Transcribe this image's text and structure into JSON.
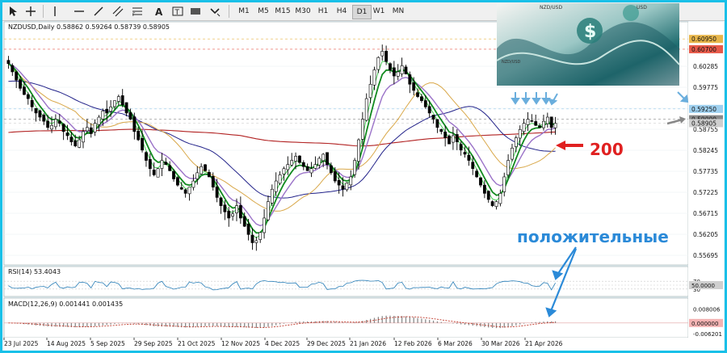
{
  "toolbar": {
    "timeframes": [
      "M1",
      "M5",
      "M15",
      "M30",
      "H1",
      "H4",
      "D1",
      "W1",
      "MN"
    ],
    "icons": [
      "cursor-icon",
      "crosshair-icon",
      "vertical-line-icon",
      "horizontal-line-icon",
      "trendline-icon",
      "channel-icon",
      "fibonacci-icon",
      "text-icon",
      "label-icon",
      "rectangle-icon",
      "arrow-icon"
    ]
  },
  "main": {
    "title": "NZDUSD,Daily 0.58862 0.59264 0.58739 0.58905"
  },
  "annotations": {
    "ma_label": "200",
    "caption": "положительные",
    "logo_text": "$",
    "logo_small_1": "NZD/USD",
    "logo_small_2": "USD",
    "logo_small_3": "NZD/USD"
  },
  "chart_data": [
    {
      "type": "candlestick",
      "panel": "price",
      "symbol": "NZDUSD",
      "timeframe": "Daily",
      "ohlc_last": {
        "open": 0.58862,
        "high": 0.59264,
        "low": 0.58739,
        "close": 0.58905
      },
      "x_ticks": [
        "23 Jul 2025",
        "14 Aug 2025",
        "5 Sep 2025",
        "29 Sep 2025",
        "21 Oct 2025",
        "12 Nov 2025",
        "4 Dec 2025",
        "29 Dec 2025",
        "21 Jan 2026",
        "12 Feb 2026",
        "6 Mar 2026",
        "30 Mar 2026",
        "21 Apr 2026"
      ],
      "y_ticks": [
        0.55695,
        0.56205,
        0.56715,
        0.57225,
        0.57735,
        0.58245,
        0.58755,
        0.59265,
        0.59775,
        0.60285
      ],
      "ylim": [
        0.555,
        0.6115
      ],
      "price_tags": [
        {
          "value": 0.6095,
          "color": "#e8b64a",
          "text": "0.60950"
        },
        {
          "value": 0.607,
          "color": "#e85a4a",
          "text": "0.60700"
        },
        {
          "value": 0.5925,
          "color": "#9fd0ef",
          "text": "0.59250"
        },
        {
          "value": 0.59,
          "color": "#8a8a8a",
          "text": "0.59000"
        },
        {
          "value": 0.58905,
          "color": "#cfcfcf",
          "text": "0.58905"
        }
      ],
      "series_style": {
        "ma_green": "#108a1e",
        "ma_light_green": "#4cd05a",
        "ma_purple": "#9a72c8",
        "ma_tan": "#d9a84a",
        "ma_navy": "#23238a",
        "ma_200": "#b22222"
      },
      "closes": [
        0.6035,
        0.6015,
        0.5995,
        0.5975,
        0.596,
        0.595,
        0.593,
        0.5915,
        0.5905,
        0.5895,
        0.588,
        0.5885,
        0.59,
        0.589,
        0.587,
        0.586,
        0.5845,
        0.5835,
        0.585,
        0.587,
        0.588,
        0.5865,
        0.589,
        0.5905,
        0.592,
        0.5915,
        0.593,
        0.5945,
        0.5955,
        0.5935,
        0.5915,
        0.59,
        0.587,
        0.585,
        0.5825,
        0.58,
        0.578,
        0.5765,
        0.578,
        0.58,
        0.579,
        0.5775,
        0.5755,
        0.574,
        0.573,
        0.572,
        0.5735,
        0.575,
        0.577,
        0.5785,
        0.5775,
        0.576,
        0.5735,
        0.571,
        0.569,
        0.5675,
        0.566,
        0.567,
        0.569,
        0.566,
        0.564,
        0.562,
        0.56,
        0.5605,
        0.5625,
        0.566,
        0.57,
        0.573,
        0.575,
        0.5765,
        0.578,
        0.579,
        0.58,
        0.581,
        0.5795,
        0.5785,
        0.5775,
        0.578,
        0.579,
        0.5805,
        0.5815,
        0.579,
        0.577,
        0.575,
        0.574,
        0.573,
        0.5745,
        0.576,
        0.58,
        0.585,
        0.59,
        0.595,
        0.5985,
        0.602,
        0.605,
        0.6065,
        0.604,
        0.602,
        0.6005,
        0.6015,
        0.603,
        0.601,
        0.5985,
        0.597,
        0.5955,
        0.5945,
        0.593,
        0.5915,
        0.59,
        0.588,
        0.587,
        0.5855,
        0.584,
        0.586,
        0.5845,
        0.5825,
        0.5815,
        0.58,
        0.578,
        0.576,
        0.574,
        0.572,
        0.5705,
        0.569,
        0.57,
        0.572,
        0.576,
        0.58,
        0.583,
        0.5855,
        0.5875,
        0.589,
        0.59,
        0.5895,
        0.5885,
        0.588,
        0.5895,
        0.5905,
        0.588,
        0.589
      ]
    },
    {
      "type": "line",
      "panel": "rsi",
      "title": "RSI(14) 53.4043",
      "y_ticks": [
        70,
        30
      ],
      "value_tag": {
        "value": 50.0,
        "text": "50.0000"
      },
      "ylim": [
        0,
        100
      ],
      "last": 53.4043
    },
    {
      "type": "histogram",
      "panel": "macd",
      "title": "MACD(12,26,9) 0.001441 0.001435",
      "y_ticks": [
        0.008006,
        -0.006201
      ],
      "value_tag": {
        "value": 0.0,
        "text": "0.000000"
      },
      "ylim": [
        -0.0075,
        0.0092
      ],
      "macd_last": 0.001441,
      "signal_last": 0.001435
    }
  ]
}
